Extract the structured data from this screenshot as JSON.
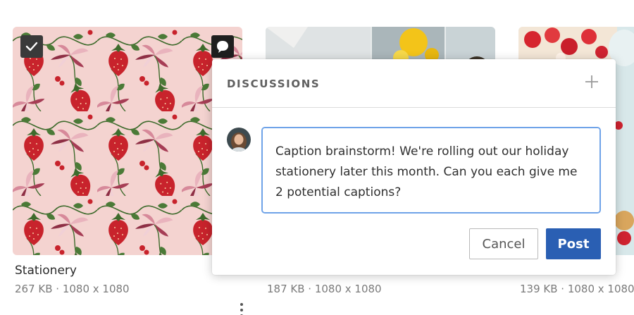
{
  "gallery": {
    "cards": [
      {
        "title": "Stationery",
        "meta": "267 KB  ·  1080 x 1080",
        "selected": true
      },
      {
        "title": "",
        "meta": "187 KB  ·  1080 x 1080"
      },
      {
        "title": "",
        "meta": "139 KB  ·  1080 x 1080"
      }
    ]
  },
  "discussions": {
    "title": "DISCUSSIONS",
    "add_icon": "plus-icon",
    "message": "Caption brainstorm! We're rolling out our holiday stationery later this month. Can you each give me 2 potential captions?",
    "cancel_label": "Cancel",
    "post_label": "Post"
  },
  "icons": {
    "selected": "checkmark-icon",
    "comment": "speech-bubble-icon",
    "more": "more-vertical-icon"
  },
  "colors": {
    "accent": "#2a5fb3",
    "input_focus": "#6fa3e8",
    "pattern_bg": "#f4d3d0",
    "strawberry": "#c8232c"
  }
}
